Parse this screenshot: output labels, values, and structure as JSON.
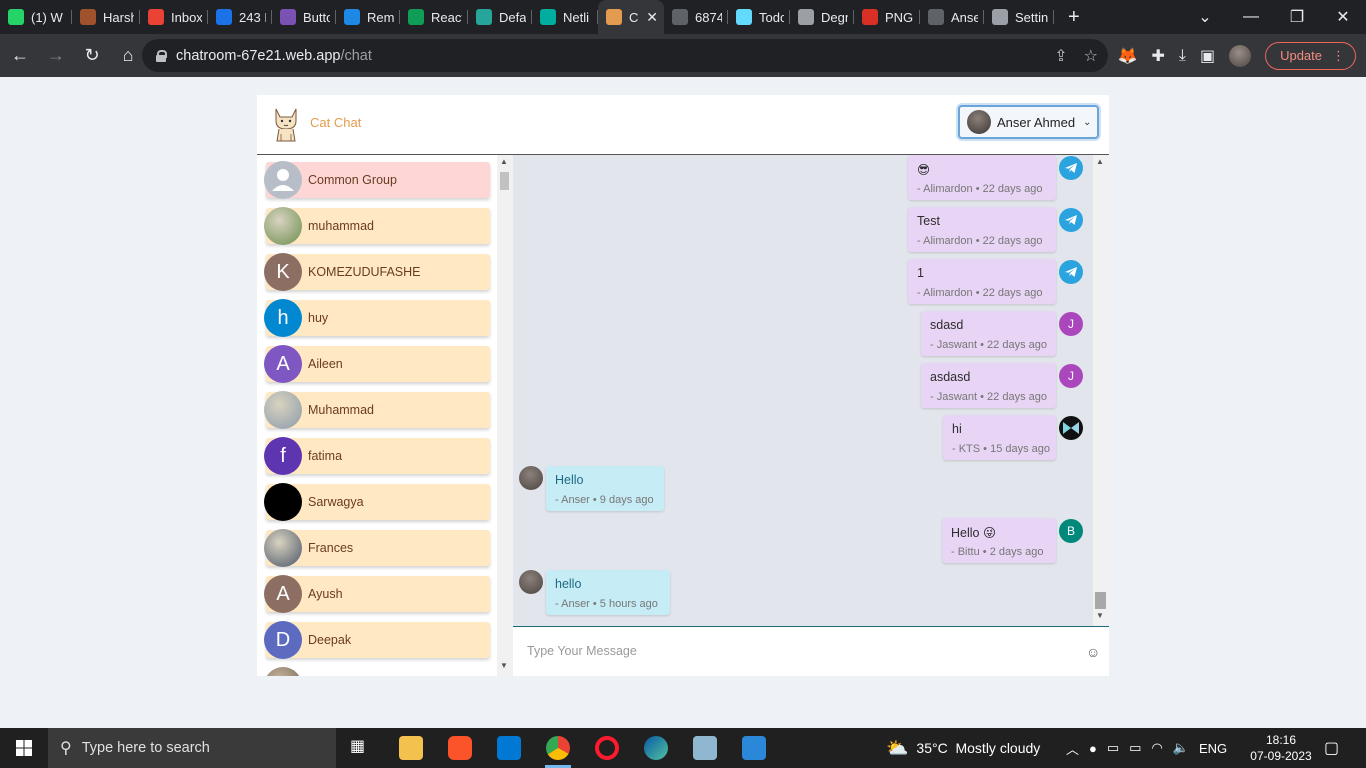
{
  "browser": {
    "tabs": [
      {
        "title": "(1) W",
        "favicon": "whatsapp-icon",
        "color": "#25d366"
      },
      {
        "title": "Harsh",
        "favicon": "person-icon",
        "color": "#a0522d"
      },
      {
        "title": "Inbox",
        "favicon": "gmail-icon",
        "color": "#ea4335"
      },
      {
        "title": "243 I",
        "favicon": "is-icon",
        "color": "#1a73e8"
      },
      {
        "title": "Butto",
        "favicon": "bootstrap-icon",
        "color": "#7952b3"
      },
      {
        "title": "Remi",
        "favicon": "flag-icon",
        "color": "#1e88e5"
      },
      {
        "title": "React",
        "favicon": "webflow-icon",
        "color": "#0f9d58"
      },
      {
        "title": "Defa",
        "favicon": "bolt-icon",
        "color": "#26a69a"
      },
      {
        "title": "Netli",
        "favicon": "netlify-icon",
        "color": "#00ad9f"
      },
      {
        "title": "C",
        "favicon": "cat-icon",
        "color": "#e39c4f",
        "active": true
      },
      {
        "title": "6874",
        "favicon": "globe-icon",
        "color": "#5f6368"
      },
      {
        "title": "Todo",
        "favicon": "react-icon",
        "color": "#61dafb"
      },
      {
        "title": "Degn",
        "favicon": "lock-icon",
        "color": "#9aa0a6"
      },
      {
        "title": "PNG",
        "favicon": "png-icon",
        "color": "#d93025"
      },
      {
        "title": "Anse",
        "favicon": "globe-icon",
        "color": "#5f6368"
      },
      {
        "title": "Settin",
        "favicon": "gear-icon",
        "color": "#9aa0a6"
      }
    ],
    "url_host": "chatroom-67e21.web.app",
    "url_path": "/chat",
    "update_label": "Update"
  },
  "app": {
    "title": "Cat Chat",
    "current_user": "Anser Ahmed"
  },
  "contacts": [
    {
      "name": "Common Group",
      "initial": "",
      "avatar_color": "#b0b4bc",
      "group": true
    },
    {
      "name": "muhammad",
      "initial": "",
      "avatar_color": "#6b8e4e",
      "photo": true
    },
    {
      "name": "KOMEZUDUFASHE",
      "initial": "K",
      "avatar_color": "#8d6e63"
    },
    {
      "name": "huy",
      "initial": "h",
      "avatar_color": "#0288d1"
    },
    {
      "name": "Aileen",
      "initial": "A",
      "avatar_color": "#7e57c2"
    },
    {
      "name": "Muhammad",
      "initial": "",
      "avatar_color": "#8a9aaa",
      "photo": true
    },
    {
      "name": "fatima",
      "initial": "f",
      "avatar_color": "#5e35b1"
    },
    {
      "name": "Sarwagya",
      "initial": "",
      "avatar_color": "#000000"
    },
    {
      "name": "Frances",
      "initial": "",
      "avatar_color": "#4a5568",
      "photo": true
    },
    {
      "name": "Ayush",
      "initial": "A",
      "avatar_color": "#8d6e63"
    },
    {
      "name": "Deepak",
      "initial": "D",
      "avatar_color": "#5c6bc0"
    }
  ],
  "messages": [
    {
      "text": "😎",
      "author": "Alimardon",
      "time": "22 days ago",
      "mine": false,
      "avatar": "telegram-icon",
      "avatar_color": "#2aa3df"
    },
    {
      "text": "Test",
      "author": "Alimardon",
      "time": "22 days ago",
      "mine": false,
      "avatar": "telegram-icon",
      "avatar_color": "#2aa3df"
    },
    {
      "text": "1",
      "author": "Alimardon",
      "time": "22 days ago",
      "mine": false,
      "avatar": "telegram-icon",
      "avatar_color": "#2aa3df"
    },
    {
      "text": "sdasd",
      "author": "Jaswant",
      "time": "22 days ago",
      "mine": false,
      "avatar": "J",
      "avatar_color": "#ab47bc"
    },
    {
      "text": "asdasd",
      "author": "Jaswant",
      "time": "22 days ago",
      "mine": false,
      "avatar": "J",
      "avatar_color": "#ab47bc"
    },
    {
      "text": "hi",
      "author": "KTS",
      "time": "15 days ago",
      "mine": false,
      "avatar": "kts-logo-icon",
      "avatar_color": "#111111"
    },
    {
      "text": "Hello",
      "author": "Anser",
      "time": "9 days ago",
      "mine": true,
      "avatar": "photo",
      "avatar_color": "#4a4440"
    },
    {
      "text": "Hello 😜",
      "author": "Bittu",
      "time": "2 days ago",
      "mine": false,
      "avatar": "B",
      "avatar_color": "#00897b"
    },
    {
      "text": "hello",
      "author": "Anser",
      "time": "5 hours ago",
      "mine": true,
      "avatar": "photo",
      "avatar_color": "#4a4440"
    }
  ],
  "composer": {
    "placeholder": "Type Your Message"
  },
  "taskbar": {
    "search_placeholder": "Type here to search",
    "weather": "35°C  Mostly cloudy",
    "language": "ENG",
    "time": "18:16",
    "date": "07-09-2023"
  }
}
